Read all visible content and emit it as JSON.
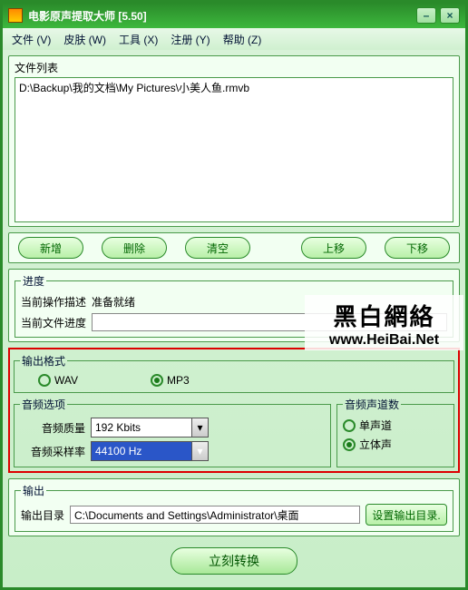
{
  "title": "电影原声提取大师  [5.50]",
  "menubar": [
    {
      "label": "文件 (V)"
    },
    {
      "label": "皮肤 (W)"
    },
    {
      "label": "工具 (X)"
    },
    {
      "label": "注册 (Y)"
    },
    {
      "label": "帮助 (Z)"
    }
  ],
  "filelist": {
    "label": "文件列表",
    "items": [
      "D:\\Backup\\我的文档\\My Pictures\\小美人鱼.rmvb"
    ]
  },
  "buttons": {
    "add": "新增",
    "del": "删除",
    "clear": "清空",
    "up": "上移",
    "down": "下移"
  },
  "progress": {
    "legend": "进度",
    "opLabel": "当前操作描述",
    "opValue": "准备就绪",
    "fileLabel": "当前文件进度"
  },
  "outFormat": {
    "legend": "输出格式",
    "wav": "WAV",
    "mp3": "MP3",
    "selected": "mp3"
  },
  "audioOpt": {
    "legend": "音频选项",
    "qualityLabel": "音频质量",
    "qualityValue": "192 Kbits",
    "rateLabel": "音频采样率",
    "rateValue": "44100 Hz"
  },
  "channels": {
    "legend": "音频声道数",
    "mono": "单声道",
    "stereo": "立体声",
    "selected": "stereo"
  },
  "output": {
    "legend": "输出",
    "dirLabel": "输出目录",
    "dirValue": "C:\\Documents and Settings\\Administrator\\桌面",
    "setBtn": "设置输出目录."
  },
  "convertBtn": "立刻转换",
  "watermark": {
    "line1": "黑白網絡",
    "line2": "www.HeiBai.Net"
  }
}
